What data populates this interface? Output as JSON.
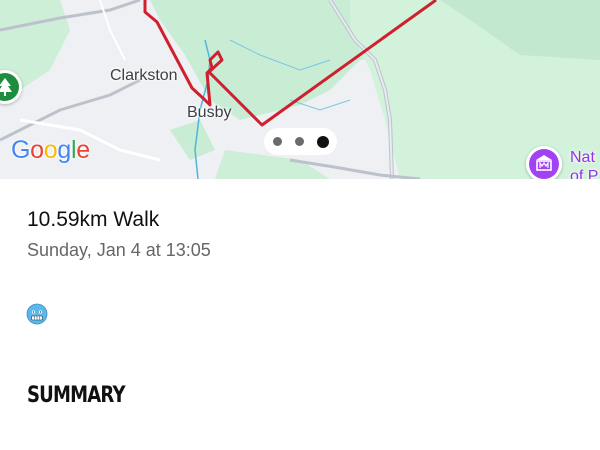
{
  "map": {
    "place_labels": {
      "clarkston": "Clarkston",
      "busby": "Busby"
    },
    "poi_partial_label": "Nat\nof P",
    "google_logo": [
      "G",
      "o",
      "o",
      "g",
      "l",
      "e"
    ],
    "left_poi_icon": "tree-icon",
    "right_poi_icon": "museum-icon",
    "pager": {
      "count": 3,
      "active_index": 2
    },
    "colors": {
      "route": "#d0202e",
      "park": "#c8ecd4",
      "water": "#4fb6d8",
      "road": "#bcc2cc"
    }
  },
  "activity": {
    "title": "10.59km Walk",
    "datetime": "Sunday, Jan 4 at 13:05",
    "mood_emoji": "cold-face-icon"
  },
  "summary": {
    "heading": "SUMMARY"
  }
}
